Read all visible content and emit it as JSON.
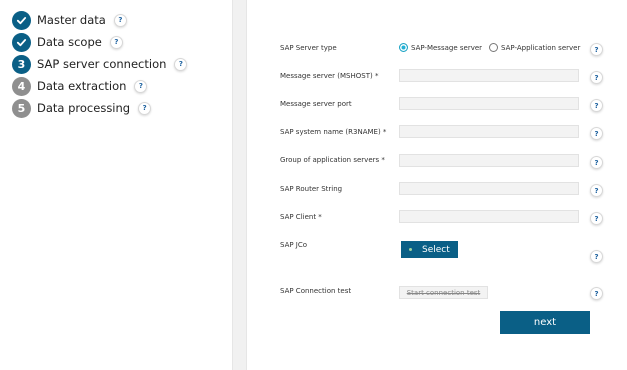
{
  "steps": [
    {
      "number": "",
      "label": "Master data",
      "state": "done"
    },
    {
      "number": "",
      "label": "Data scope",
      "state": "done"
    },
    {
      "number": "3",
      "label": "SAP server connection",
      "state": "active"
    },
    {
      "number": "4",
      "label": "Data extraction",
      "state": "pending"
    },
    {
      "number": "5",
      "label": "Data processing",
      "state": "pending"
    }
  ],
  "help_symbol": "?",
  "form": {
    "server_type_label": "SAP Server type",
    "server_type_options": [
      "SAP-Message server",
      "SAP-Application server"
    ],
    "server_type_selected": "SAP-Message server",
    "fields": [
      {
        "label": "Message server (MSHOST) *",
        "value": ""
      },
      {
        "label": "Message server port",
        "value": ""
      },
      {
        "label": "SAP system name (R3NAME) *",
        "value": ""
      },
      {
        "label": "Group of application servers *",
        "value": ""
      },
      {
        "label": "SAP Router String",
        "value": ""
      },
      {
        "label": "SAP Client *",
        "value": ""
      }
    ],
    "jco_label": "SAP JCo",
    "select_label": "Select",
    "connection_test_label": "SAP Connection test",
    "connection_test_button": "Start connection test"
  },
  "next_label": "next",
  "colors": {
    "primary": "#0a5f86",
    "pending": "#8f8f8f",
    "radio_checked": "#23b1d6"
  },
  "icons": {
    "done": "checkmark-icon",
    "help": "question-mark-icon"
  }
}
